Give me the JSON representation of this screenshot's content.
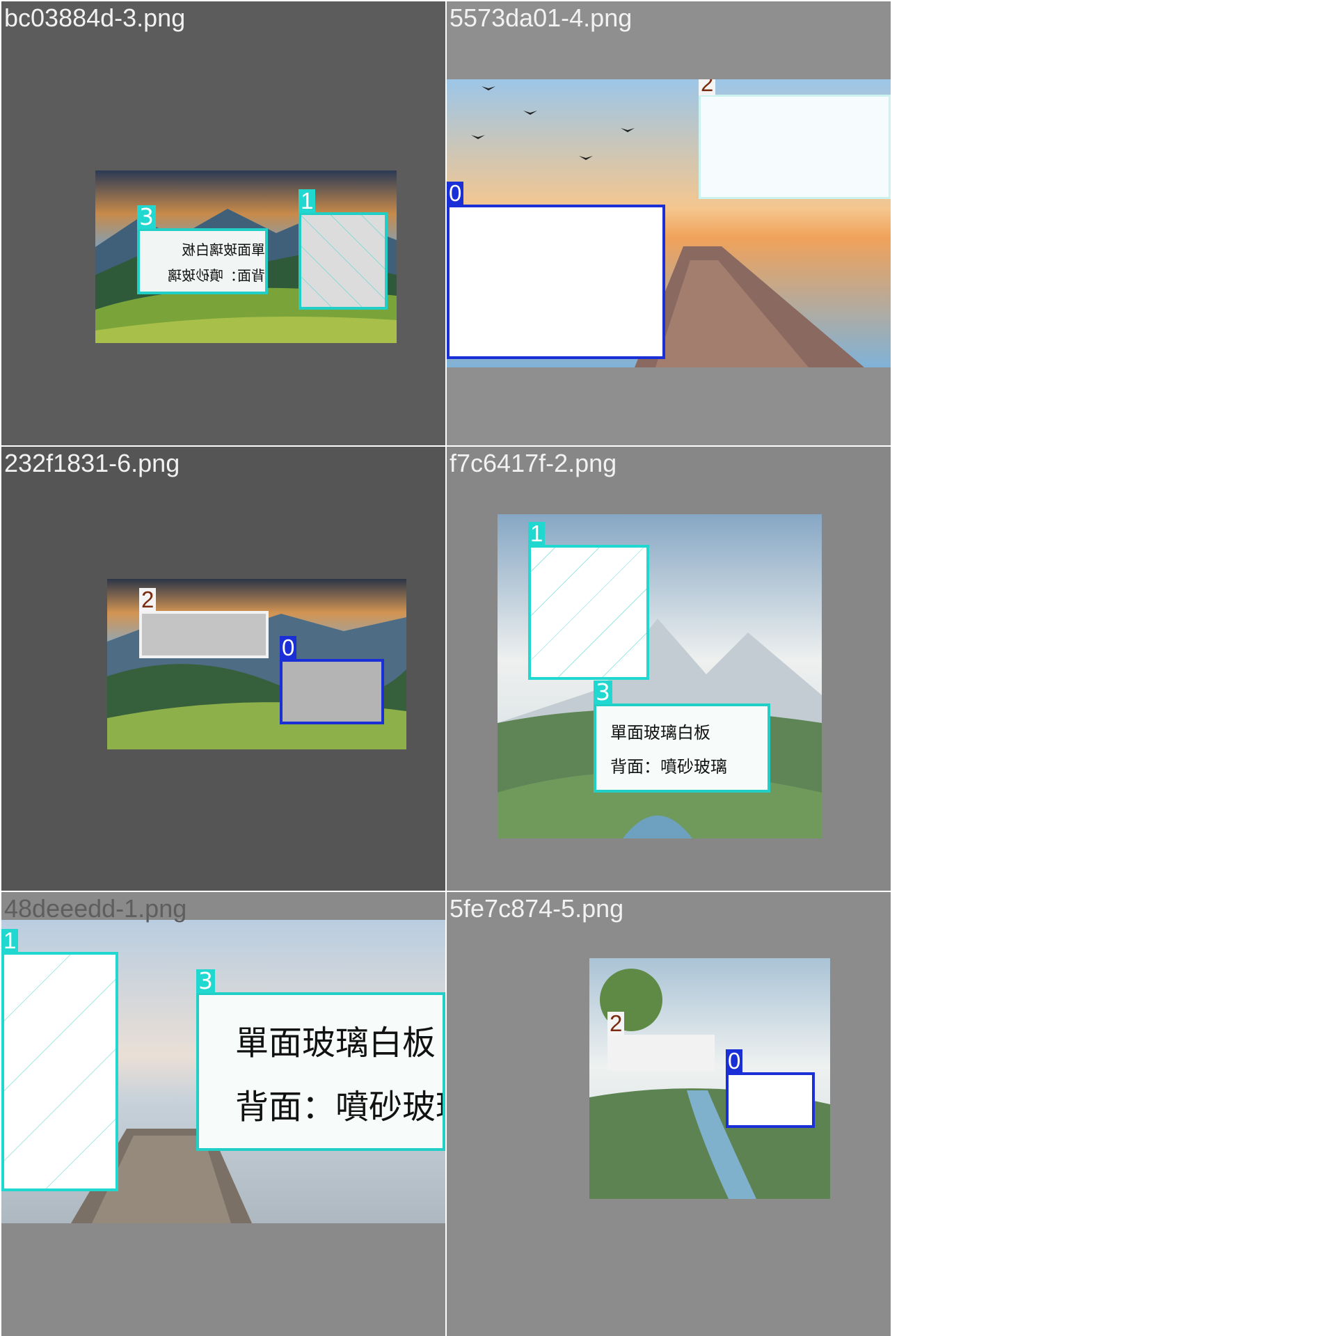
{
  "tiles": {
    "t1": {
      "filename": "bc03884d-3.png",
      "box3": {
        "tag": "3",
        "line1": "單面玻璃白板",
        "line2": "背面：噴砂玻璃"
      },
      "box1": {
        "tag": "1"
      }
    },
    "t2": {
      "filename": "5573da01-4.png",
      "box2": {
        "tag": "2"
      },
      "box0": {
        "tag": "0"
      }
    },
    "t3": {
      "filename": "232f1831-6.png",
      "box2": {
        "tag": "2"
      },
      "box0": {
        "tag": "0"
      }
    },
    "t4": {
      "filename": "f7c6417f-2.png",
      "box1": {
        "tag": "1"
      },
      "box3": {
        "tag": "3",
        "line1": "單面玻璃白板",
        "line2": "背面：噴砂玻璃"
      }
    },
    "t5": {
      "filename": "48deeedd-1.png",
      "box1": {
        "tag": "1"
      },
      "box3": {
        "tag": "3",
        "line1": "單面玻璃白板",
        "line2": "背面：噴砂玻璃"
      }
    },
    "t6": {
      "filename": "5fe7c874-5.png",
      "box2": {
        "tag": "2"
      },
      "box0": {
        "tag": "0"
      }
    }
  },
  "colors": {
    "tag_cyan": "#20d8d0",
    "tag_blue": "#1a2fd6",
    "tile_bg_dark": "#5a5a5a",
    "tile_bg_mid": "#888888",
    "tile_bg_light": "#8c8c8c"
  }
}
